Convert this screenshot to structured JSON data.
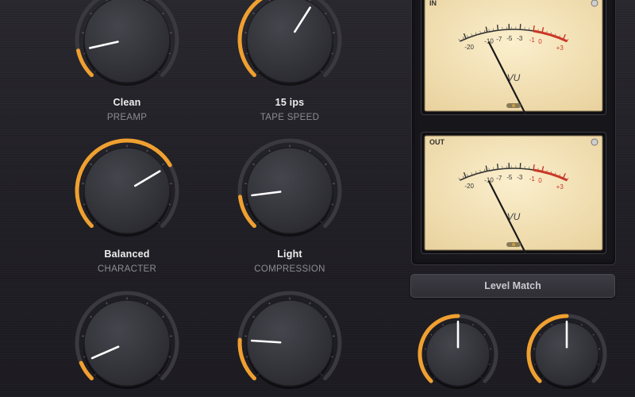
{
  "colors": {
    "accent": "#f0a030",
    "track": "#3a3940",
    "knob_body": "#35353c",
    "pointer": "#ffffff",
    "meter_face": "#f5e6be",
    "meter_red": "#c83828"
  },
  "knobs": [
    {
      "id": "preamp",
      "value": "Clean",
      "label": "PREAMP",
      "level": 0.12
    },
    {
      "id": "tape-speed",
      "value": "15 ips",
      "label": "TAPE SPEED",
      "level": 0.62
    },
    {
      "id": "character",
      "value": "Balanced",
      "label": "CHARACTER",
      "level": 0.72
    },
    {
      "id": "compression",
      "value": "Light",
      "label": "COMPRESSION",
      "level": 0.14
    },
    {
      "id": "knob-5",
      "value": "",
      "label": "",
      "level": 0.08
    },
    {
      "id": "knob-6",
      "value": "",
      "label": "",
      "level": 0.18
    },
    {
      "id": "level-in",
      "value": "",
      "label": "",
      "level": 0.5
    },
    {
      "id": "level-out",
      "value": "",
      "label": "",
      "level": 0.5
    }
  ],
  "meters": [
    {
      "id": "in",
      "title": "IN",
      "unit": "VU",
      "scale": [
        "-20",
        "-10",
        "-7",
        "-5",
        "-3",
        "-1",
        "0",
        "+3"
      ],
      "needle_level": 0.05
    },
    {
      "id": "out",
      "title": "OUT",
      "unit": "VU",
      "scale": [
        "-20",
        "-10",
        "-7",
        "-5",
        "-3",
        "-1",
        "0",
        "+3"
      ],
      "needle_level": 0.05
    }
  ],
  "level_match": {
    "label": "Level Match"
  }
}
